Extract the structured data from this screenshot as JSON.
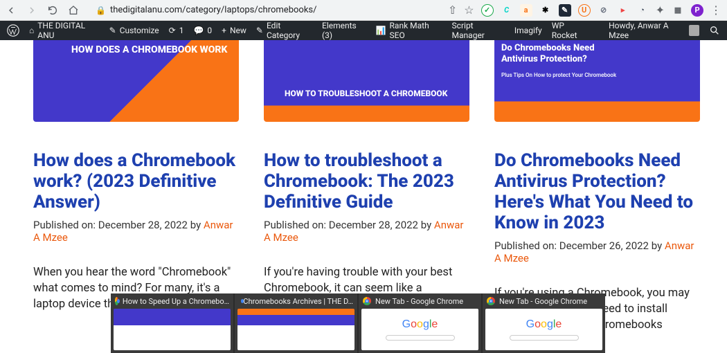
{
  "browser": {
    "url": "thedigitalanu.com/category/laptops/chromebooks/",
    "ext_icons": [
      {
        "bg": "#ffffff",
        "fg": "#1ba94c",
        "txt": "✓",
        "round": true
      },
      {
        "bg": "#ffffff",
        "fg": "#00d4c7",
        "txt": "C",
        "round": false
      },
      {
        "bg": "#fff4e5",
        "fg": "#f97316",
        "txt": "a",
        "round": false
      },
      {
        "bg": "#ffffff",
        "fg": "#000000",
        "txt": "✱",
        "round": true
      },
      {
        "bg": "#1f2937",
        "fg": "#ffffff",
        "txt": "✎",
        "round": false
      },
      {
        "bg": "#ffffff",
        "fg": "#f97316",
        "txt": "U",
        "round": true
      },
      {
        "bg": "#ffffff",
        "fg": "#6b7280",
        "txt": "⊘",
        "round": true
      },
      {
        "bg": "#ffffff",
        "fg": "#ef4444",
        "txt": "▸",
        "round": false
      },
      {
        "bg": "#ffffff",
        "fg": "#374151",
        "txt": "◐",
        "round": false
      }
    ],
    "profile_letter": "P"
  },
  "wpbar": {
    "site_name": "THE DIGITAL ANU",
    "customize": "Customize",
    "updates": "1",
    "comments": "0",
    "new": "New",
    "edit_category": "Edit Category",
    "elements": "Elements (3)",
    "rank_math": "Rank Math SEO",
    "script_manager": "Script Manager",
    "imagify": "Imagify",
    "wp_rocket": "WP Rocket",
    "howdy": "Howdy, Anwar A Mzee"
  },
  "posts": [
    {
      "thumb_text": "HOW DOES A CHROMEBOOK WORK",
      "title": "How does a Chromebook work? (2023 Definitive Answer)",
      "published_label": "Published on:",
      "date": "December 28, 2022",
      "by": "by",
      "author": "Anwar A Mzee",
      "excerpt": "When you hear the word \"Chromebook\" what comes to mind? For many, it's a laptop device that works a bit differently"
    },
    {
      "thumb_text": "HOW TO TROUBLESHOOT A CHROMEBOOK",
      "title": "How to troubleshoot a Chromebook: The 2023 Definitive Guide",
      "published_label": "Published on:",
      "date": "December 28, 2022",
      "by": "by",
      "author": "Anwar A Mzee",
      "excerpt": "If you're having trouble with your best Chromebook, it can seem like a"
    },
    {
      "thumb_text": "Do Chromebooks Need Antivirus Protection?",
      "thumb_sub": "Plus Tips On How to protect Your Chromebook",
      "title": "Do Chromebooks Need Antivirus Protection? Here's What You Need to Know in 2023",
      "published_label": "Published on:",
      "date": "December 26, 2022",
      "by": "by",
      "author": "Anwar A Mzee",
      "excerpt": "If you're using a Chromebook, you may be wondering if you need to install antivirus software. Chromebooks"
    }
  ],
  "taskbar": [
    {
      "title": "How to Speed Up a Chromebo…",
      "preview": "article"
    },
    {
      "title": "Chromebooks Archives | THE D…",
      "preview": "article"
    },
    {
      "title": "New Tab - Google Chrome",
      "preview": "google"
    },
    {
      "title": "New Tab - Google Chrome",
      "preview": "google"
    }
  ]
}
